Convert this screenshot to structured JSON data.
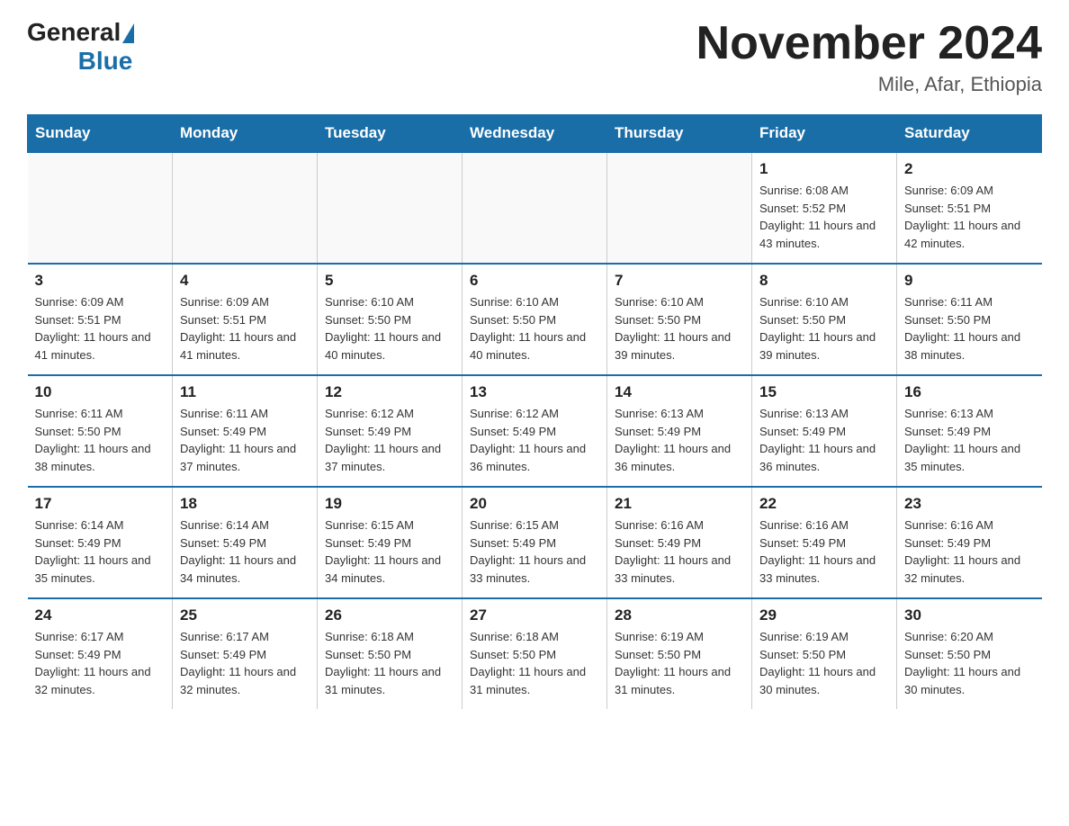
{
  "header": {
    "logo_general": "General",
    "logo_blue": "Blue",
    "month_year": "November 2024",
    "location": "Mile, Afar, Ethiopia"
  },
  "days_of_week": [
    "Sunday",
    "Monday",
    "Tuesday",
    "Wednesday",
    "Thursday",
    "Friday",
    "Saturday"
  ],
  "weeks": [
    [
      {
        "day": "",
        "info": ""
      },
      {
        "day": "",
        "info": ""
      },
      {
        "day": "",
        "info": ""
      },
      {
        "day": "",
        "info": ""
      },
      {
        "day": "",
        "info": ""
      },
      {
        "day": "1",
        "info": "Sunrise: 6:08 AM\nSunset: 5:52 PM\nDaylight: 11 hours and 43 minutes."
      },
      {
        "day": "2",
        "info": "Sunrise: 6:09 AM\nSunset: 5:51 PM\nDaylight: 11 hours and 42 minutes."
      }
    ],
    [
      {
        "day": "3",
        "info": "Sunrise: 6:09 AM\nSunset: 5:51 PM\nDaylight: 11 hours and 41 minutes."
      },
      {
        "day": "4",
        "info": "Sunrise: 6:09 AM\nSunset: 5:51 PM\nDaylight: 11 hours and 41 minutes."
      },
      {
        "day": "5",
        "info": "Sunrise: 6:10 AM\nSunset: 5:50 PM\nDaylight: 11 hours and 40 minutes."
      },
      {
        "day": "6",
        "info": "Sunrise: 6:10 AM\nSunset: 5:50 PM\nDaylight: 11 hours and 40 minutes."
      },
      {
        "day": "7",
        "info": "Sunrise: 6:10 AM\nSunset: 5:50 PM\nDaylight: 11 hours and 39 minutes."
      },
      {
        "day": "8",
        "info": "Sunrise: 6:10 AM\nSunset: 5:50 PM\nDaylight: 11 hours and 39 minutes."
      },
      {
        "day": "9",
        "info": "Sunrise: 6:11 AM\nSunset: 5:50 PM\nDaylight: 11 hours and 38 minutes."
      }
    ],
    [
      {
        "day": "10",
        "info": "Sunrise: 6:11 AM\nSunset: 5:50 PM\nDaylight: 11 hours and 38 minutes."
      },
      {
        "day": "11",
        "info": "Sunrise: 6:11 AM\nSunset: 5:49 PM\nDaylight: 11 hours and 37 minutes."
      },
      {
        "day": "12",
        "info": "Sunrise: 6:12 AM\nSunset: 5:49 PM\nDaylight: 11 hours and 37 minutes."
      },
      {
        "day": "13",
        "info": "Sunrise: 6:12 AM\nSunset: 5:49 PM\nDaylight: 11 hours and 36 minutes."
      },
      {
        "day": "14",
        "info": "Sunrise: 6:13 AM\nSunset: 5:49 PM\nDaylight: 11 hours and 36 minutes."
      },
      {
        "day": "15",
        "info": "Sunrise: 6:13 AM\nSunset: 5:49 PM\nDaylight: 11 hours and 36 minutes."
      },
      {
        "day": "16",
        "info": "Sunrise: 6:13 AM\nSunset: 5:49 PM\nDaylight: 11 hours and 35 minutes."
      }
    ],
    [
      {
        "day": "17",
        "info": "Sunrise: 6:14 AM\nSunset: 5:49 PM\nDaylight: 11 hours and 35 minutes."
      },
      {
        "day": "18",
        "info": "Sunrise: 6:14 AM\nSunset: 5:49 PM\nDaylight: 11 hours and 34 minutes."
      },
      {
        "day": "19",
        "info": "Sunrise: 6:15 AM\nSunset: 5:49 PM\nDaylight: 11 hours and 34 minutes."
      },
      {
        "day": "20",
        "info": "Sunrise: 6:15 AM\nSunset: 5:49 PM\nDaylight: 11 hours and 33 minutes."
      },
      {
        "day": "21",
        "info": "Sunrise: 6:16 AM\nSunset: 5:49 PM\nDaylight: 11 hours and 33 minutes."
      },
      {
        "day": "22",
        "info": "Sunrise: 6:16 AM\nSunset: 5:49 PM\nDaylight: 11 hours and 33 minutes."
      },
      {
        "day": "23",
        "info": "Sunrise: 6:16 AM\nSunset: 5:49 PM\nDaylight: 11 hours and 32 minutes."
      }
    ],
    [
      {
        "day": "24",
        "info": "Sunrise: 6:17 AM\nSunset: 5:49 PM\nDaylight: 11 hours and 32 minutes."
      },
      {
        "day": "25",
        "info": "Sunrise: 6:17 AM\nSunset: 5:49 PM\nDaylight: 11 hours and 32 minutes."
      },
      {
        "day": "26",
        "info": "Sunrise: 6:18 AM\nSunset: 5:50 PM\nDaylight: 11 hours and 31 minutes."
      },
      {
        "day": "27",
        "info": "Sunrise: 6:18 AM\nSunset: 5:50 PM\nDaylight: 11 hours and 31 minutes."
      },
      {
        "day": "28",
        "info": "Sunrise: 6:19 AM\nSunset: 5:50 PM\nDaylight: 11 hours and 31 minutes."
      },
      {
        "day": "29",
        "info": "Sunrise: 6:19 AM\nSunset: 5:50 PM\nDaylight: 11 hours and 30 minutes."
      },
      {
        "day": "30",
        "info": "Sunrise: 6:20 AM\nSunset: 5:50 PM\nDaylight: 11 hours and 30 minutes."
      }
    ]
  ]
}
